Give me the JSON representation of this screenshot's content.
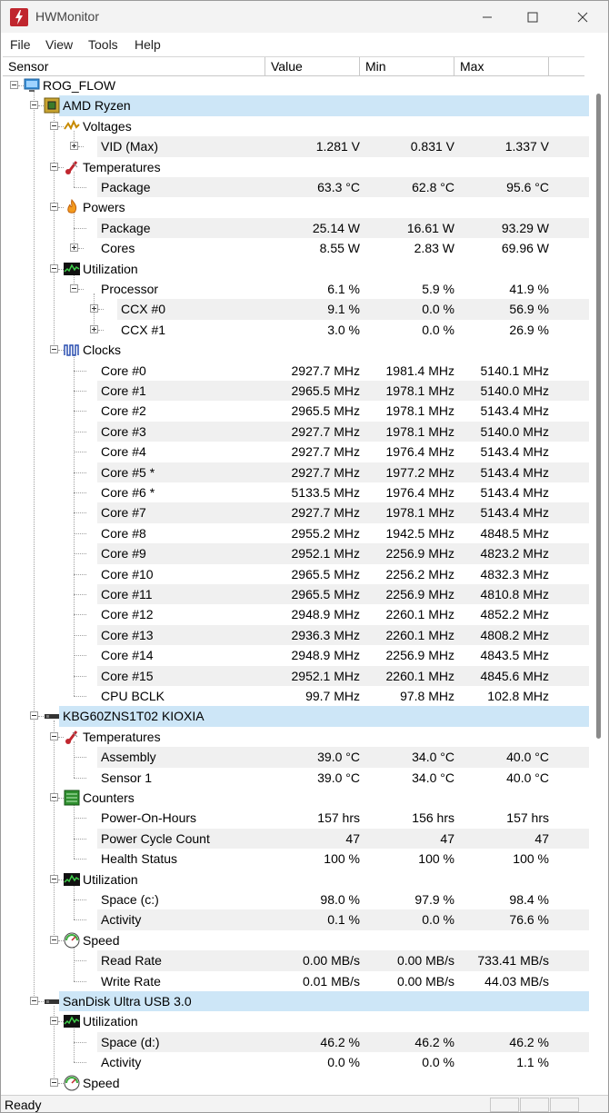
{
  "window": {
    "title": "HWMonitor"
  },
  "menu": [
    "File",
    "View",
    "Tools",
    "Help"
  ],
  "columns": [
    "Sensor",
    "Value",
    "Min",
    "Max"
  ],
  "status": "Ready",
  "colors": {
    "selected_row": "#cde6f7",
    "stripe": "#f0f0f0",
    "app_icon": "#c0262e"
  },
  "tree": [
    {
      "level": 0,
      "exp": "minus",
      "icon": "computer-icon",
      "label": "ROG_FLOW"
    },
    {
      "level": 1,
      "exp": "minus",
      "icon": "cpu-chip-icon",
      "label": "AMD Ryzen",
      "sel": true
    },
    {
      "level": 2,
      "exp": "minus",
      "icon": "voltage-icon",
      "label": "Voltages"
    },
    {
      "level": 3,
      "exp": "plus",
      "label": "VID (Max)",
      "v": [
        "1.281 V",
        "0.831 V",
        "1.337 V"
      ]
    },
    {
      "level": 2,
      "exp": "minus",
      "icon": "thermometer-icon",
      "label": "Temperatures"
    },
    {
      "level": 3,
      "label": "Package",
      "v": [
        "63.3 °C",
        "62.8 °C",
        "95.6 °C"
      ]
    },
    {
      "level": 2,
      "exp": "minus",
      "icon": "flame-icon",
      "label": "Powers"
    },
    {
      "level": 3,
      "label": "Package",
      "v": [
        "25.14 W",
        "16.61 W",
        "93.29 W"
      ]
    },
    {
      "level": 3,
      "exp": "plus",
      "label": "Cores",
      "v": [
        "8.55 W",
        "2.83 W",
        "69.96 W"
      ]
    },
    {
      "level": 2,
      "exp": "minus",
      "icon": "utilization-icon",
      "label": "Utilization"
    },
    {
      "level": 3,
      "exp": "minus",
      "label": "Processor",
      "v": [
        "6.1 %",
        "5.9 %",
        "41.9 %"
      ]
    },
    {
      "level": 4,
      "exp": "plus",
      "label": "CCX #0",
      "v": [
        "9.1 %",
        "0.0 %",
        "56.9 %"
      ]
    },
    {
      "level": 4,
      "exp": "plus",
      "label": "CCX #1",
      "v": [
        "3.0 %",
        "0.0 %",
        "26.9 %"
      ]
    },
    {
      "level": 2,
      "exp": "minus",
      "icon": "clock-wave-icon",
      "label": "Clocks"
    },
    {
      "level": 3,
      "label": "Core #0",
      "v": [
        "2927.7 MHz",
        "1981.4 MHz",
        "5140.1 MHz"
      ]
    },
    {
      "level": 3,
      "label": "Core #1",
      "v": [
        "2965.5 MHz",
        "1978.1 MHz",
        "5140.0 MHz"
      ]
    },
    {
      "level": 3,
      "label": "Core #2",
      "v": [
        "2965.5 MHz",
        "1978.1 MHz",
        "5143.4 MHz"
      ]
    },
    {
      "level": 3,
      "label": "Core #3",
      "v": [
        "2927.7 MHz",
        "1978.1 MHz",
        "5140.0 MHz"
      ]
    },
    {
      "level": 3,
      "label": "Core #4",
      "v": [
        "2927.7 MHz",
        "1976.4 MHz",
        "5143.4 MHz"
      ]
    },
    {
      "level": 3,
      "label": "Core #5 *",
      "v": [
        "2927.7 MHz",
        "1977.2 MHz",
        "5143.4 MHz"
      ]
    },
    {
      "level": 3,
      "label": "Core #6 *",
      "v": [
        "5133.5 MHz",
        "1976.4 MHz",
        "5143.4 MHz"
      ]
    },
    {
      "level": 3,
      "label": "Core #7",
      "v": [
        "2927.7 MHz",
        "1978.1 MHz",
        "5143.4 MHz"
      ]
    },
    {
      "level": 3,
      "label": "Core #8",
      "v": [
        "2955.2 MHz",
        "1942.5 MHz",
        "4848.5 MHz"
      ]
    },
    {
      "level": 3,
      "label": "Core #9",
      "v": [
        "2952.1 MHz",
        "2256.9 MHz",
        "4823.2 MHz"
      ]
    },
    {
      "level": 3,
      "label": "Core #10",
      "v": [
        "2965.5 MHz",
        "2256.2 MHz",
        "4832.3 MHz"
      ]
    },
    {
      "level": 3,
      "label": "Core #11",
      "v": [
        "2965.5 MHz",
        "2256.9 MHz",
        "4810.8 MHz"
      ]
    },
    {
      "level": 3,
      "label": "Core #12",
      "v": [
        "2948.9 MHz",
        "2260.1 MHz",
        "4852.2 MHz"
      ]
    },
    {
      "level": 3,
      "label": "Core #13",
      "v": [
        "2936.3 MHz",
        "2260.1 MHz",
        "4808.2 MHz"
      ]
    },
    {
      "level": 3,
      "label": "Core #14",
      "v": [
        "2948.9 MHz",
        "2256.9 MHz",
        "4843.5 MHz"
      ]
    },
    {
      "level": 3,
      "label": "Core #15",
      "v": [
        "2952.1 MHz",
        "2260.1 MHz",
        "4845.6 MHz"
      ]
    },
    {
      "level": 3,
      "label": "CPU BCLK",
      "v": [
        "99.7 MHz",
        "97.8 MHz",
        "102.8 MHz"
      ]
    },
    {
      "level": 1,
      "exp": "minus",
      "icon": "drive-icon",
      "label": "KBG60ZNS1T02 KIOXIA",
      "sel": true
    },
    {
      "level": 2,
      "exp": "minus",
      "icon": "thermometer-icon",
      "label": "Temperatures"
    },
    {
      "level": 3,
      "label": "Assembly",
      "v": [
        "39.0 °C",
        "34.0 °C",
        "40.0 °C"
      ]
    },
    {
      "level": 3,
      "label": "Sensor 1",
      "v": [
        "39.0 °C",
        "34.0 °C",
        "40.0 °C"
      ]
    },
    {
      "level": 2,
      "exp": "minus",
      "icon": "counter-icon",
      "label": "Counters"
    },
    {
      "level": 3,
      "label": "Power-On-Hours",
      "v": [
        "157 hrs",
        "156 hrs",
        "157 hrs"
      ]
    },
    {
      "level": 3,
      "label": "Power Cycle Count",
      "v": [
        "47",
        "47",
        "47"
      ]
    },
    {
      "level": 3,
      "label": "Health Status",
      "v": [
        "100 %",
        "100 %",
        "100 %"
      ]
    },
    {
      "level": 2,
      "exp": "minus",
      "icon": "utilization-icon",
      "label": "Utilization"
    },
    {
      "level": 3,
      "label": "Space (c:)",
      "v": [
        "98.0 %",
        "97.9 %",
        "98.4 %"
      ]
    },
    {
      "level": 3,
      "label": "Activity",
      "v": [
        "0.1 %",
        "0.0 %",
        "76.6 %"
      ]
    },
    {
      "level": 2,
      "exp": "minus",
      "icon": "speed-gauge-icon",
      "label": "Speed"
    },
    {
      "level": 3,
      "label": "Read Rate",
      "v": [
        "0.00 MB/s",
        "0.00 MB/s",
        "733.41 MB/s"
      ]
    },
    {
      "level": 3,
      "label": "Write Rate",
      "v": [
        "0.01 MB/s",
        "0.00 MB/s",
        "44.03 MB/s"
      ]
    },
    {
      "level": 1,
      "exp": "minus",
      "icon": "drive-icon",
      "label": "SanDisk Ultra USB 3.0",
      "sel": true
    },
    {
      "level": 2,
      "exp": "minus",
      "icon": "utilization-icon",
      "label": "Utilization"
    },
    {
      "level": 3,
      "label": "Space (d:)",
      "v": [
        "46.2 %",
        "46.2 %",
        "46.2 %"
      ]
    },
    {
      "level": 3,
      "label": "Activity",
      "v": [
        "0.0 %",
        "0.0 %",
        "1.1 %"
      ]
    },
    {
      "level": 2,
      "exp": "minus",
      "icon": "speed-gauge-icon",
      "label": "Speed"
    }
  ]
}
